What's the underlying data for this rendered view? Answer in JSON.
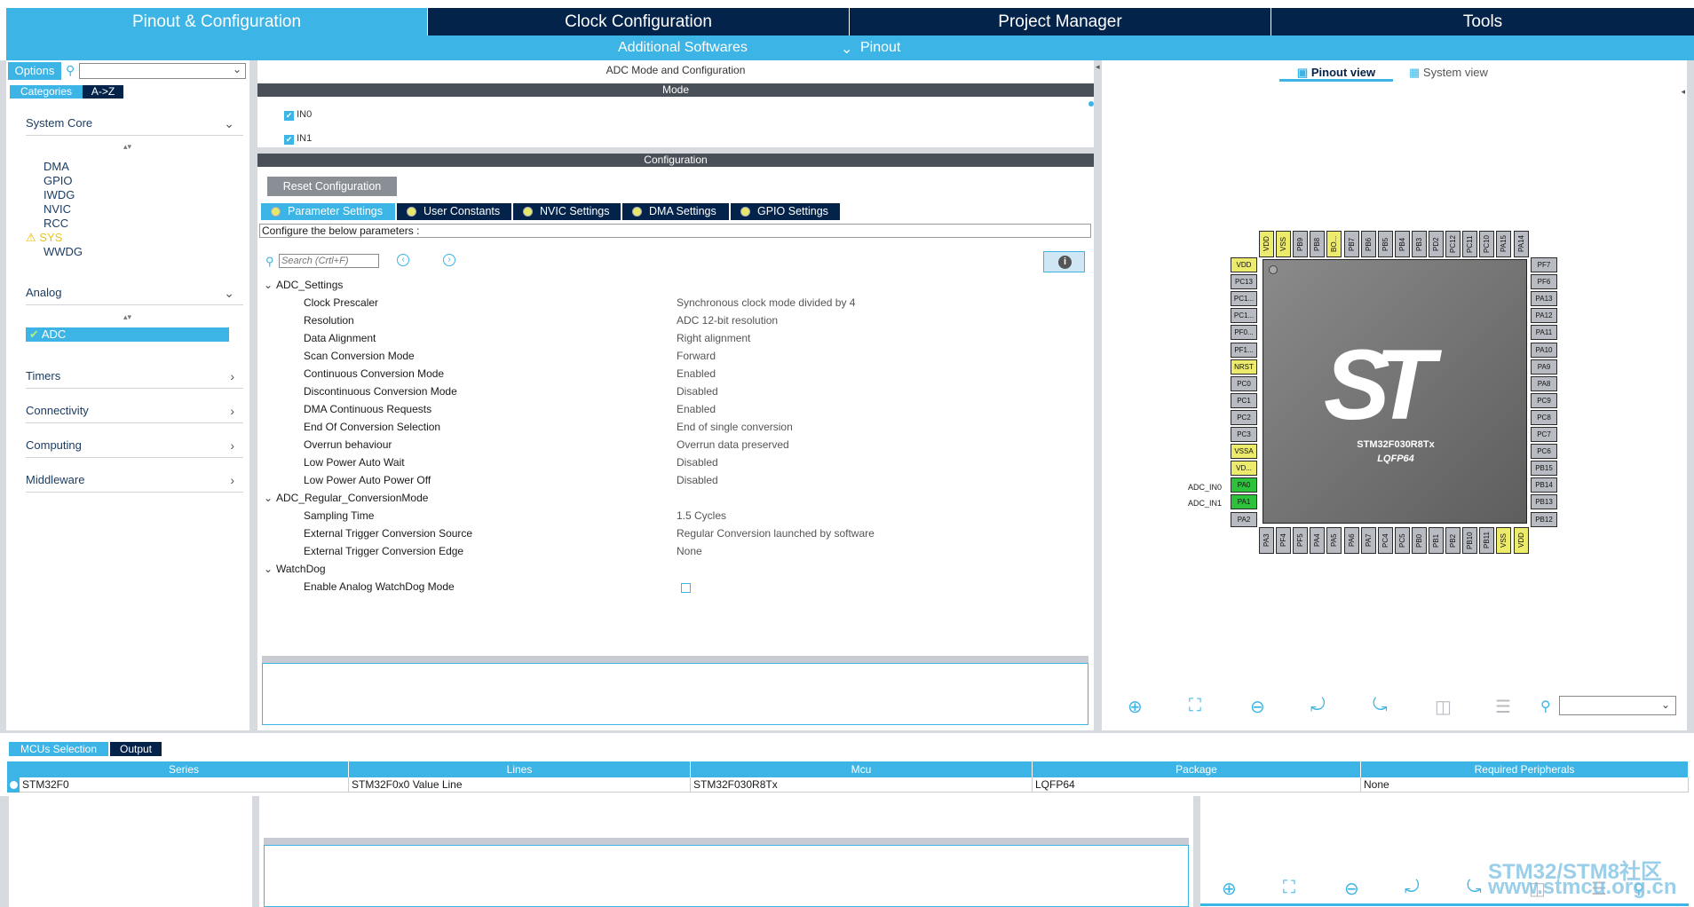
{
  "top_tabs": [
    "Pinout & Configuration",
    "Clock Configuration",
    "Project Manager",
    "Tools"
  ],
  "sub_menu": {
    "additional": "Additional Softwares",
    "pinout": "Pinout",
    "chevron": "chevron-down-icon"
  },
  "left": {
    "options": "Options",
    "categories": "Categories",
    "az": "A->Z",
    "system_core": "System Core",
    "system_core_items": [
      "DMA",
      "GPIO",
      "IWDG",
      "NVIC",
      "RCC",
      "SYS",
      "WWDG"
    ],
    "analog": "Analog",
    "analog_items": [
      "ADC"
    ],
    "groups": [
      "Timers",
      "Connectivity",
      "Computing",
      "Middleware"
    ]
  },
  "center": {
    "title": "ADC Mode and Configuration",
    "mode_header": "Mode",
    "mode_items": [
      "IN0",
      "IN1"
    ],
    "config_header": "Configuration",
    "reset": "Reset Configuration",
    "ptabs": [
      "Parameter Settings",
      "User Constants",
      "NVIC Settings",
      "DMA Settings",
      "GPIO Settings"
    ],
    "configure_text": "Configure the below parameters :",
    "search_placeholder": "Search (Crtl+F)",
    "groups": [
      {
        "name": "ADC_Settings",
        "rows": [
          [
            "Clock Prescaler",
            "Synchronous clock mode divided by 4"
          ],
          [
            "Resolution",
            "ADC 12-bit resolution"
          ],
          [
            "Data Alignment",
            "Right alignment"
          ],
          [
            "Scan Conversion Mode",
            "Forward"
          ],
          [
            "Continuous Conversion Mode",
            "Enabled"
          ],
          [
            "Discontinuous Conversion Mode",
            "Disabled"
          ],
          [
            "DMA Continuous Requests",
            "Enabled"
          ],
          [
            "End Of Conversion Selection",
            "End of single conversion"
          ],
          [
            "Overrun behaviour",
            "Overrun data preserved"
          ],
          [
            "Low Power Auto Wait",
            "Disabled"
          ],
          [
            "Low Power Auto Power Off",
            "Disabled"
          ]
        ]
      },
      {
        "name": "ADC_Regular_ConversionMode",
        "rows": [
          [
            "Sampling Time",
            "1.5 Cycles"
          ],
          [
            "External Trigger Conversion Source",
            "Regular Conversion launched by software"
          ],
          [
            "External Trigger Conversion Edge",
            "None"
          ]
        ]
      },
      {
        "name": "WatchDog",
        "rows": [
          [
            "Enable Analog WatchDog Mode",
            ""
          ]
        ]
      }
    ]
  },
  "right": {
    "pinout_view": "Pinout view",
    "system_view": "System view",
    "chip_name": "STM32F030R8Tx",
    "package": "LQFP64",
    "logo": "ST",
    "labels": [
      "ADC_IN0",
      "ADC_IN1"
    ],
    "top_pins": [
      "VDD",
      "VSS",
      "PB9",
      "PB8",
      "BO...",
      "PB7",
      "PB6",
      "PB5",
      "PB4",
      "PB3",
      "PD2",
      "PC12",
      "PC11",
      "PC10",
      "PA15",
      "PA14"
    ],
    "left_pins": [
      "VDD",
      "PC13",
      "PC1...",
      "PC1...",
      "PF0...",
      "PF1...",
      "NRST",
      "PC0",
      "PC1",
      "PC2",
      "PC3",
      "VSSA",
      "VD...",
      "PA0",
      "PA1",
      "PA2"
    ],
    "right_pins": [
      "PF7",
      "PF6",
      "PA13",
      "PA12",
      "PA11",
      "PA10",
      "PA9",
      "PA8",
      "PC9",
      "PC8",
      "PC7",
      "PC6",
      "PB15",
      "PB14",
      "PB13",
      "PB12"
    ],
    "bottom_pins": [
      "PA3",
      "PF4",
      "PF5",
      "PA4",
      "PA5",
      "PA6",
      "PA7",
      "PC4",
      "PC5",
      "PB0",
      "PB1",
      "PB2",
      "PB10",
      "PB11",
      "VSS",
      "VDD"
    ]
  },
  "bottom": {
    "tabs": [
      "MCUs Selection",
      "Output"
    ],
    "columns": [
      "Series",
      "Lines",
      "Mcu",
      "Package",
      "Required Peripherals"
    ],
    "row": [
      "STM32F0",
      "STM32F0x0 Value Line",
      "STM32F030R8Tx",
      "LQFP64",
      "None"
    ]
  },
  "watermark": [
    "STM32/STM8社区",
    "www.stmcu.org.cn"
  ]
}
